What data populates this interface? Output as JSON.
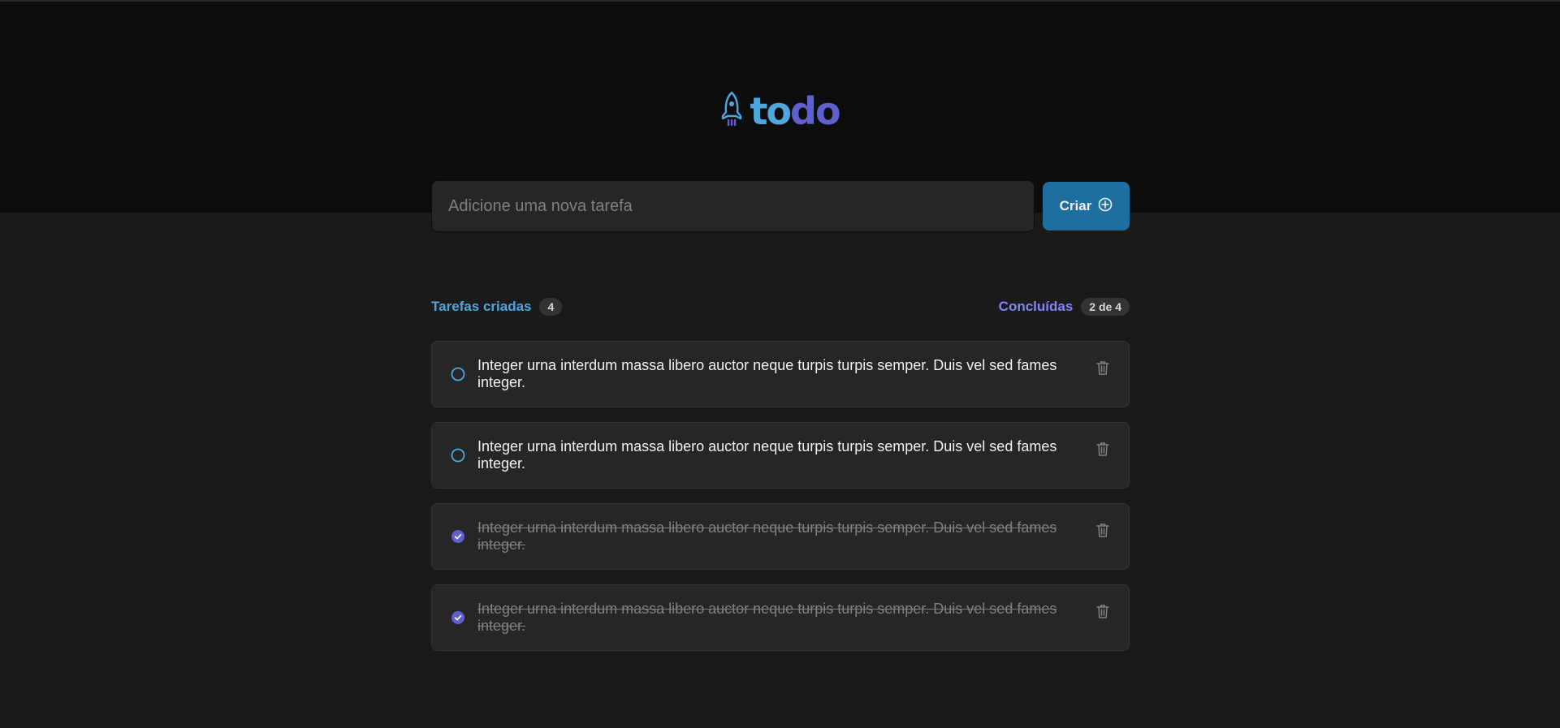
{
  "app": {
    "logo": {
      "part1": "to",
      "part2": "do",
      "icon": "rocket-icon"
    },
    "colors": {
      "blue": "#4ea8de",
      "purple": "#8284fa",
      "purple_dark": "#5e60ce",
      "button": "#1e6f9f"
    }
  },
  "create": {
    "placeholder": "Adicione uma nova tarefa",
    "value": "",
    "button_label": "Criar",
    "button_icon": "plus-circle-icon"
  },
  "stats": {
    "created_label": "Tarefas criadas",
    "created_count": "4",
    "done_label": "Concluídas",
    "done_count": "2 de 4"
  },
  "tasks": [
    {
      "text": "Integer urna interdum massa libero auctor neque turpis turpis semper. Duis vel sed fames integer.",
      "done": false
    },
    {
      "text": "Integer urna interdum massa libero auctor neque turpis turpis semper. Duis vel sed fames integer.",
      "done": false
    },
    {
      "text": "Integer urna interdum massa libero auctor neque turpis turpis semper. Duis vel sed fames integer.",
      "done": true
    },
    {
      "text": "Integer urna interdum massa libero auctor neque turpis turpis semper. Duis vel sed fames integer.",
      "done": true
    }
  ]
}
